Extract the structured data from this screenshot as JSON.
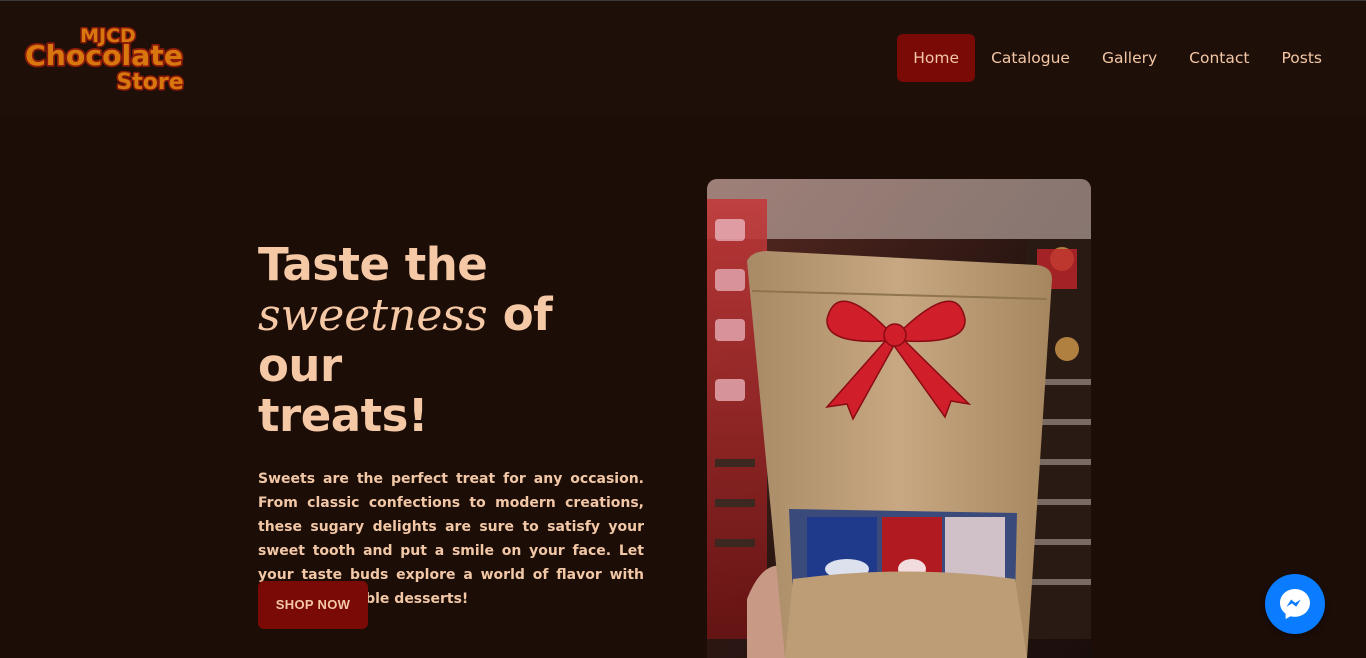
{
  "brand": {
    "line1": "MJCD",
    "line2": "Chocolate",
    "line3": "Store",
    "primary_color": "#d9770f",
    "outline_color": "#8a1a0a"
  },
  "nav": {
    "items": [
      {
        "label": "Home",
        "active": true
      },
      {
        "label": "Catalogue",
        "active": false
      },
      {
        "label": "Gallery",
        "active": false
      },
      {
        "label": "Contact",
        "active": false
      },
      {
        "label": "Posts",
        "active": false
      }
    ]
  },
  "hero": {
    "title_part1": "Taste the",
    "title_emphasis": "sweetness",
    "title_part2": " of our",
    "title_part3": "treats!",
    "description": "Sweets are the perfect treat for any occasion. From classic confections to modern creations, these sugary delights are sure to satisfy your sweet tooth and put a smile on your face. Let your taste buds explore a world of flavor with these delectable desserts!",
    "cta_label": "SHOP NOW"
  },
  "colors": {
    "background": "#1c0d07",
    "accent": "#7a0a06",
    "text": "#f6c9a6",
    "messenger": "#0a7cff"
  },
  "icons": {
    "chat": "messenger-icon"
  }
}
